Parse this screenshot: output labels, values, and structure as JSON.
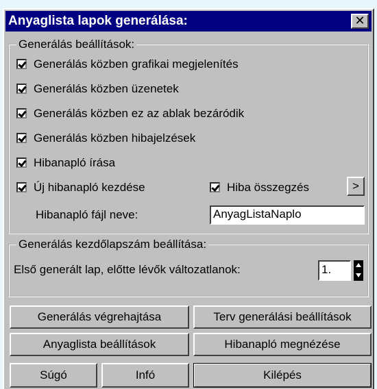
{
  "window": {
    "title": "Anyaglista lapok generálása:",
    "close_glyph": "✕"
  },
  "settings_group": {
    "legend": "Generálás beállítások:",
    "options": [
      {
        "label": "Generálás közben grafikai megjelenítés",
        "checked": true
      },
      {
        "label": "Generálás közben üzenetek",
        "checked": true
      },
      {
        "label": "Generálás közben ez az ablak bezáródik",
        "checked": true
      },
      {
        "label": "Generálás közben hibajelzések",
        "checked": true
      },
      {
        "label": "Hibanapló írása",
        "checked": true
      },
      {
        "label": "Új hibanapló kezdése",
        "checked": true
      }
    ],
    "error_summary": {
      "label": "Hiba összegzés",
      "checked": true
    },
    "more_button": ">",
    "logfile_label": "Hibanapló fájl neve:",
    "logfile_value": "AnyagListaNaplo"
  },
  "page_number_group": {
    "legend": "Generálás kezdőlapszám beállítása:",
    "first_page_label": "Első generált lap, előtte lévők változatlanok:",
    "first_page_value": "1."
  },
  "buttons": {
    "execute": "Generálás végrehajtása",
    "plan_settings": "Terv generálási beállítások",
    "list_settings": "Anyaglista beállítások",
    "view_log": "Hibanapló megnézése",
    "help": "Súgó",
    "info": "Infó",
    "exit": "Kilépés"
  }
}
